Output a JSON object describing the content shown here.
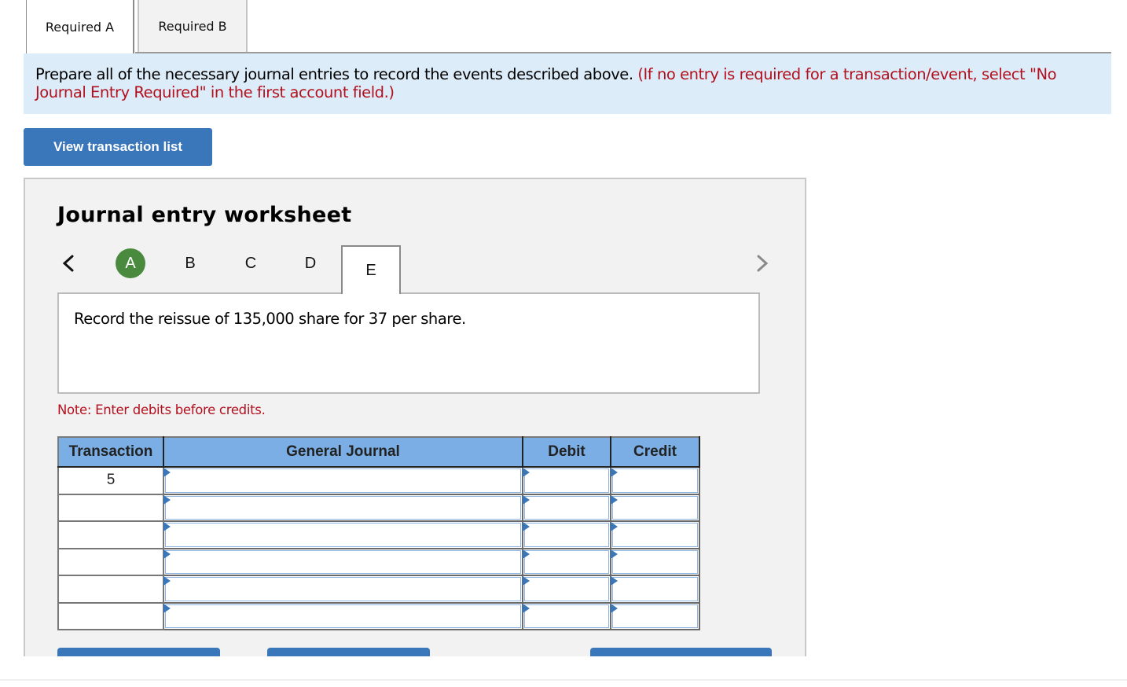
{
  "tabs": [
    {
      "label": "Required A",
      "active": true
    },
    {
      "label": "Required B",
      "active": false
    }
  ],
  "instruction": {
    "main": "Prepare all of the necessary journal entries to record the events described above.",
    "note": "(If no entry is required for a transaction/event, select \"No Journal Entry Required\" in the first account field.)"
  },
  "view_transaction_button": "View transaction list",
  "worksheet": {
    "title": "Journal entry worksheet",
    "nav_prev_icon": "chevron-left-icon",
    "nav_next_icon": "chevron-right-icon",
    "steps": [
      {
        "label": "A",
        "state": "completed"
      },
      {
        "label": "B",
        "state": "pending"
      },
      {
        "label": "C",
        "state": "pending"
      },
      {
        "label": "D",
        "state": "pending"
      },
      {
        "label": "E",
        "state": "current"
      }
    ],
    "description": "Record the reissue of 135,000 share for 37 per share.",
    "note": "Note: Enter debits before credits.",
    "table": {
      "headers": [
        "Transaction",
        "General Journal",
        "Debit",
        "Credit"
      ],
      "rows": [
        {
          "transaction": "5",
          "account": "",
          "debit": "",
          "credit": ""
        },
        {
          "transaction": "",
          "account": "",
          "debit": "",
          "credit": ""
        },
        {
          "transaction": "",
          "account": "",
          "debit": "",
          "credit": ""
        },
        {
          "transaction": "",
          "account": "",
          "debit": "",
          "credit": ""
        },
        {
          "transaction": "",
          "account": "",
          "debit": "",
          "credit": ""
        },
        {
          "transaction": "",
          "account": "",
          "debit": "",
          "credit": ""
        }
      ]
    }
  },
  "colors": {
    "accent_blue": "#3a76ba",
    "header_blue": "#7aaee5",
    "banner_bg": "#dcecf9",
    "instruction_red": "#b3101e",
    "completed_green": "#4a8a3e",
    "panel_bg": "#f2f2f2"
  }
}
